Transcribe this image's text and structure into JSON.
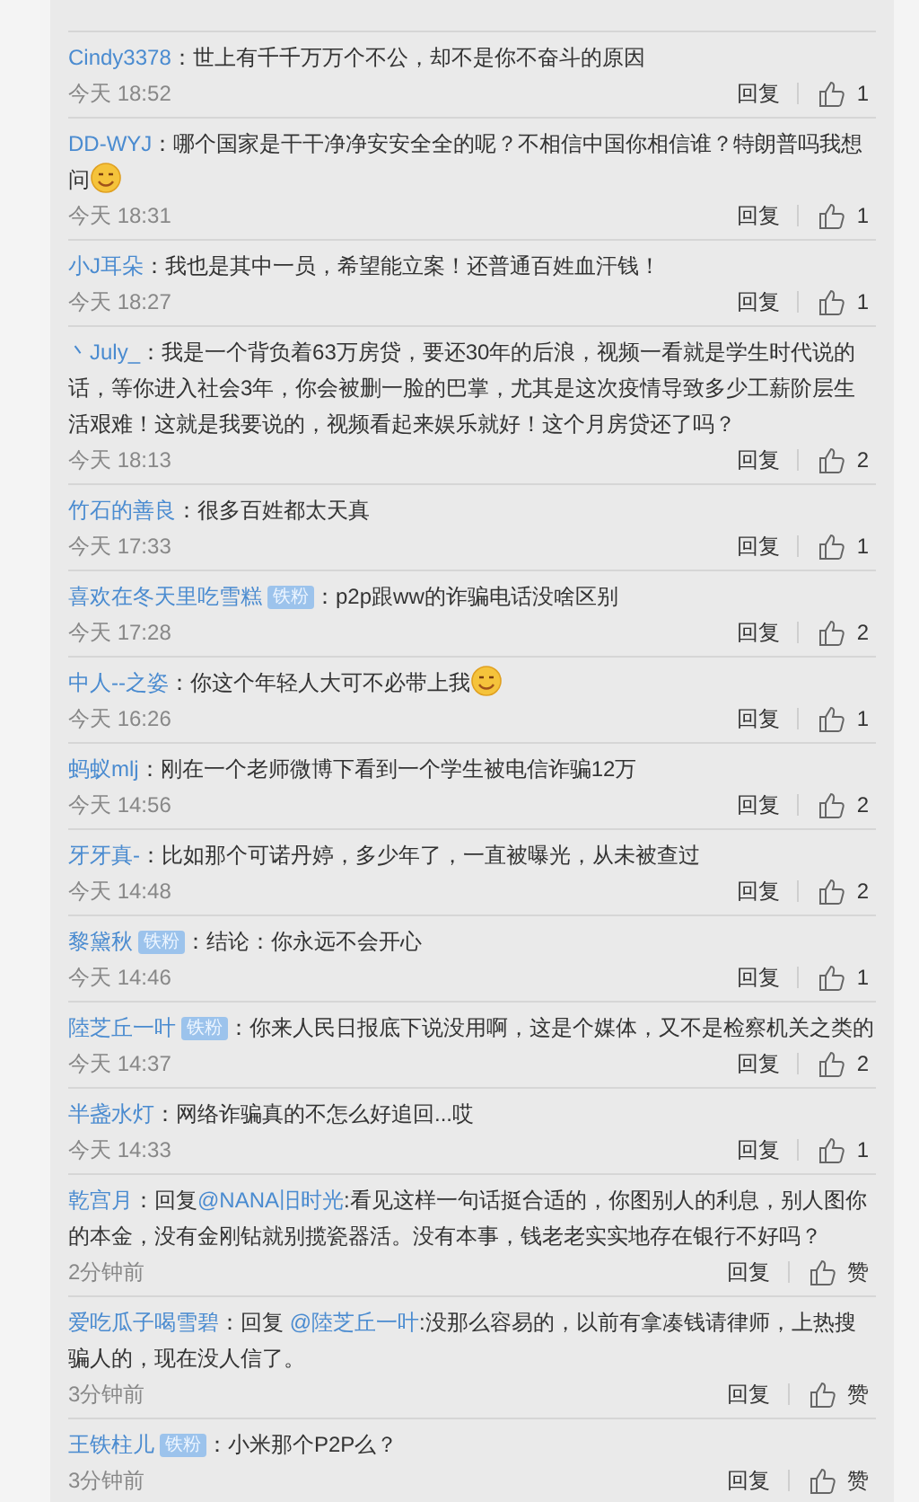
{
  "comments": [
    {
      "user": "Cindy3378",
      "text": "：世上有千千万万个不公，却不是你不奋斗的原因",
      "emoji": false,
      "time": "今天 18:52",
      "reply": "回复",
      "likes": "1"
    },
    {
      "user": "DD-WYJ",
      "text": "：哪个国家是干干净净安安全全的呢？不相信中国你相信谁？特朗普吗我想问",
      "emoji": true,
      "time": "今天 18:31",
      "reply": "回复",
      "likes": "1"
    },
    {
      "user": "小J耳朵",
      "text": "：我也是其中一员，希望能立案！还普通百姓血汗钱！",
      "emoji": false,
      "time": "今天 18:27",
      "reply": "回复",
      "likes": "1"
    },
    {
      "user": "丶July_",
      "text": "：我是一个背负着63万房贷，要还30年的后浪，视频一看就是学生时代说的话，等你进入社会3年，你会被删一脸的巴掌，尤其是这次疫情导致多少工薪阶层生活艰难！这就是我要说的，视频看起来娱乐就好！这个月房贷还了吗？",
      "emoji": false,
      "time": "今天 18:13",
      "reply": "回复",
      "likes": "2"
    },
    {
      "user": "竹石的善良",
      "text": "：很多百姓都太天真",
      "emoji": false,
      "time": "今天 17:33",
      "reply": "回复",
      "likes": "1"
    },
    {
      "user": "喜欢在冬天里吃雪糕",
      "badge": "铁粉",
      "text": "：p2p跟ww的诈骗电话没啥区别",
      "emoji": false,
      "time": "今天 17:28",
      "reply": "回复",
      "likes": "2"
    },
    {
      "user": "中人--之姿",
      "text": "：你这个年轻人大可不必带上我",
      "emoji": true,
      "time": "今天 16:26",
      "reply": "回复",
      "likes": "1"
    },
    {
      "user": "蚂蚁mlj",
      "text": "：刚在一个老师微博下看到一个学生被电信诈骗12万",
      "emoji": false,
      "time": "今天 14:56",
      "reply": "回复",
      "likes": "2"
    },
    {
      "user": "牙牙真-",
      "text": "：比如那个可诺丹婷，多少年了，一直被曝光，从未被查过",
      "emoji": false,
      "time": "今天 14:48",
      "reply": "回复",
      "likes": "2"
    },
    {
      "user": "黎黛秋",
      "badge": "铁粉",
      "text": "：结论：你永远不会开心",
      "emoji": false,
      "time": "今天 14:46",
      "reply": "回复",
      "likes": "1"
    },
    {
      "user": "陸芝丘一叶",
      "badge": "铁粉",
      "text": "：你来人民日报底下说没用啊，这是个媒体，又不是检察机关之类的",
      "emoji": false,
      "time": "今天 14:37",
      "reply": "回复",
      "likes": "2"
    },
    {
      "user": "半盏水灯",
      "text": "：网络诈骗真的不怎么好追回...哎",
      "emoji": false,
      "time": "今天 14:33",
      "reply": "回复",
      "likes": "1"
    },
    {
      "user": "乾宫月",
      "reply_prefix": "：回复",
      "mention": "@NANA旧时光",
      "text": ":看见这样一句话挺合适的，你图别人的利息，别人图你的本金，没有金刚钻就别揽瓷器活。没有本事，钱老老实实地存在银行不好吗？",
      "emoji": false,
      "time": "2分钟前",
      "reply": "回复",
      "likes": "赞"
    },
    {
      "user": "爱吃瓜子喝雪碧",
      "reply_prefix": "：回复 ",
      "mention": "@陸芝丘一叶",
      "text": ":没那么容易的，以前有拿凑钱请律师，上热搜骗人的，现在没人信了。",
      "emoji": false,
      "time": "3分钟前",
      "reply": "回复",
      "likes": "赞"
    },
    {
      "user": "王铁柱儿",
      "badge": "铁粉",
      "text": "：小米那个P2P么？",
      "emoji": false,
      "time": "3分钟前",
      "reply": "回复",
      "likes": "赞"
    }
  ]
}
